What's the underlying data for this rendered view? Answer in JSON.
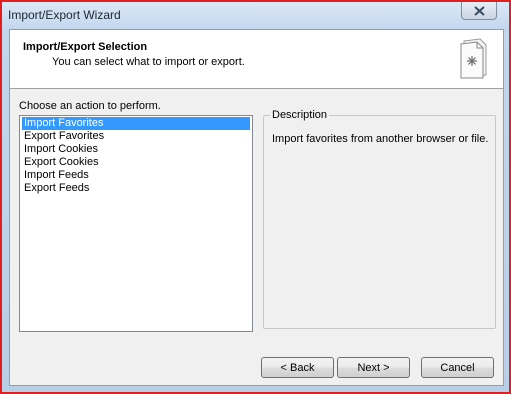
{
  "window": {
    "title": "Import/Export Wizard"
  },
  "header": {
    "title": "Import/Export Selection",
    "subtitle": "You can select what to import or export."
  },
  "actions": {
    "label": "Choose an action to perform.",
    "items": [
      {
        "label": "Import Favorites",
        "selected": true
      },
      {
        "label": "Export Favorites",
        "selected": false
      },
      {
        "label": "Import Cookies",
        "selected": false
      },
      {
        "label": "Export Cookies",
        "selected": false
      },
      {
        "label": "Import Feeds",
        "selected": false
      },
      {
        "label": "Export Feeds",
        "selected": false
      }
    ]
  },
  "description": {
    "legend": "Description",
    "text": "Import favorites from another browser or file."
  },
  "buttons": {
    "back": "< Back",
    "next": "Next >",
    "cancel": "Cancel"
  },
  "icons": {
    "close": "close-icon",
    "wizard": "wizard-document-icon"
  },
  "colors": {
    "selection": "#3399ff",
    "title_bar": "#c4d7ee",
    "window_outline": "#e02020"
  }
}
